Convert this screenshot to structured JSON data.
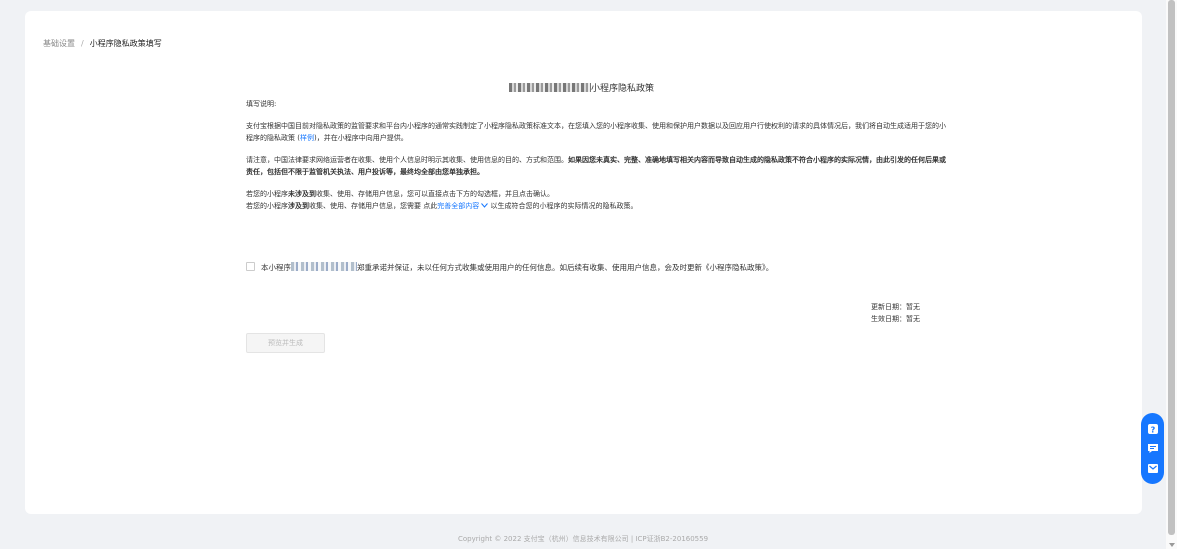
{
  "breadcrumb": {
    "parent": "基础设置",
    "separator": "/",
    "current": "小程序隐私政策填写"
  },
  "doc_title_suffix": "小程序隐私政策",
  "instructions": {
    "heading": "填写说明:",
    "p1": "支付宝根据中国目前对隐私政策的监管要求和平台内小程序的通常实践制定了小程序隐私政策标准文本，在您填入您的小程序收集、使用和保护用户数据以及回应用户行使权利的请求的具体情况后，我们将自动生成适用于您的小程序的隐私政策 (",
    "p1_link": "样例",
    "p1_end": ")，并在小程序中向用户提供。",
    "p2_normal": "请注意，中国法律要求网络运营者在收集、使用个人信息时明示其收集、使用信息的目的、方式和范围。",
    "p2_bold": "如果因您未真实、完整、准确地填写相关内容而导致自动生成的隐私政策不符合小程序的实际况情，由此引发的任何后果或责任，包括但不限于监管机关执法、用户投诉等，最终均全部由您单独承担。",
    "p3_a": "若您的小程序",
    "p3_b": "未涉及到",
    "p3_c": "收集、使用、存储用户信息，您可以直接点击下方的勾选框，并且点击确认。",
    "p4_a": "若您的小程序",
    "p4_b": "涉及到",
    "p4_c": "收集、使用、存储用户信息，您需要 点此",
    "p4_link": "完善全部内容",
    "p4_end": " 以生成符合您的小程序的实际情况的隐私政策。"
  },
  "agreement": {
    "prefix": "本小程序",
    "suffix": "郑重承诺并保证，未以任何方式收集或使用用户的任何信息。如后续有收集、使用用户信息，会及时更新《小程序隐私政策》。"
  },
  "dates": {
    "updated": "更新日期：暂无",
    "effective": "生效日期：暂无"
  },
  "generate_button": "预览并生成",
  "footer": "Copyright © 2022 支付宝（杭州）信息技术有限公司 | ICP证浙B2-20160559",
  "colors": {
    "accent": "#1677ff",
    "background": "#f0f2f5"
  },
  "float_icons": [
    "help-icon",
    "chat-icon",
    "feedback-icon"
  ]
}
